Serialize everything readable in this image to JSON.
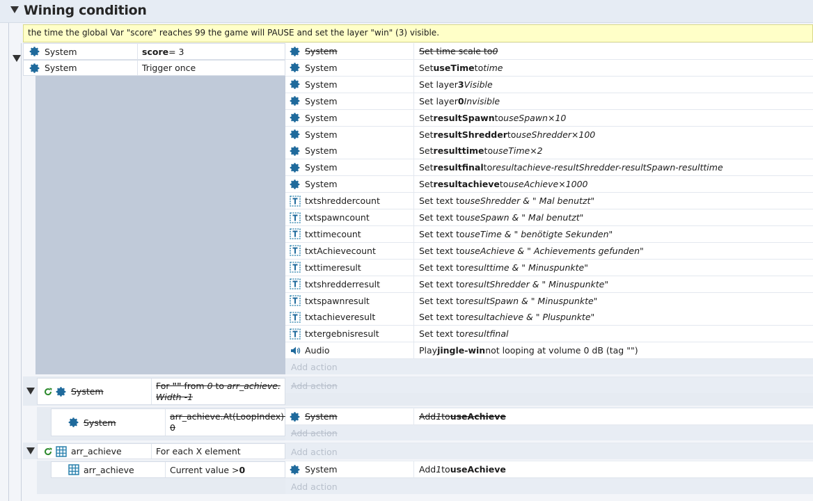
{
  "group": {
    "title": "Wining condition"
  },
  "comment": "the time the global Var \"score\" reaches 99 the game will PAUSE and set the layer \"win\" (3) visible.",
  "event1": {
    "conditions": [
      {
        "object": "System",
        "text_bold": "score",
        "text_rest": " = 3"
      },
      {
        "object": "System",
        "text": "Trigger once"
      }
    ],
    "actions": [
      {
        "object": "System",
        "icon": "gear-icon",
        "pre": "Set time scale to ",
        "italic": "0",
        "disabled": true
      },
      {
        "object": "System",
        "icon": "gear-icon",
        "pre": "Set ",
        "bold": "useTime",
        "mid": " to ",
        "italic": "time"
      },
      {
        "object": "System",
        "icon": "gear-icon",
        "pre": "Set layer ",
        "bold": "3",
        "mid": " ",
        "italic": "Visible"
      },
      {
        "object": "System",
        "icon": "gear-icon",
        "pre": "Set layer ",
        "bold": "0",
        "mid": " ",
        "italic": "Invisible"
      },
      {
        "object": "System",
        "icon": "gear-icon",
        "pre": "Set ",
        "bold": "resultSpawn",
        "mid": " to ",
        "italic": "useSpawn×10"
      },
      {
        "object": "System",
        "icon": "gear-icon",
        "pre": "Set ",
        "bold": "resultShredder",
        "mid": " to ",
        "italic": "useShredder×100"
      },
      {
        "object": "System",
        "icon": "gear-icon",
        "pre": "Set ",
        "bold": "resulttime",
        "mid": " to ",
        "italic": "useTime×2"
      },
      {
        "object": "System",
        "icon": "gear-icon",
        "pre": "Set ",
        "bold": "resultfinal",
        "mid": " to ",
        "italic": "resultachieve-resultShredder-resultSpawn-resulttime"
      },
      {
        "object": "System",
        "icon": "gear-icon",
        "pre": "Set ",
        "bold": "resultachieve",
        "mid": " to ",
        "italic": "useAchieve×1000"
      },
      {
        "object": "txtshreddercount",
        "icon": "text-icon",
        "pre": "Set text to ",
        "italic": "useShredder & \" Mal benutzt\""
      },
      {
        "object": "txtspawncount",
        "icon": "text-icon",
        "pre": "Set text to ",
        "italic": "useSpawn & \" Mal benutzt\""
      },
      {
        "object": "txttimecount",
        "icon": "text-icon",
        "pre": "Set text to ",
        "italic": "useTime & \" benötigte Sekunden\""
      },
      {
        "object": "txtAchievecount",
        "icon": "text-icon",
        "pre": "Set text to ",
        "italic": "useAchieve & \" Achievements gefunden\""
      },
      {
        "object": "txttimeresult",
        "icon": "text-icon",
        "pre": "Set text to ",
        "italic": "resulttime & \" Minuspunkte\""
      },
      {
        "object": "txtshredderresult",
        "icon": "text-icon",
        "pre": "Set text to ",
        "italic": "resultShredder & \" Minuspunkte\""
      },
      {
        "object": "txtspawnresult",
        "icon": "text-icon",
        "pre": "Set text to ",
        "italic": "resultSpawn & \" Minuspunkte\""
      },
      {
        "object": "txtachieveresult",
        "icon": "text-icon",
        "pre": "Set text to ",
        "italic": "resultachieve & \" Pluspunkte\""
      },
      {
        "object": "txtergebnisresult",
        "icon": "text-icon",
        "pre": "Set text to ",
        "italic": "resultfinal"
      },
      {
        "object": "Audio",
        "icon": "speaker-icon",
        "pre": "Play ",
        "bold": "jingle-win",
        "mid": " not looping at volume 0 dB (tag \"\")"
      }
    ],
    "add_action": "Add action"
  },
  "event2": {
    "object": "System",
    "text_pre": "For ",
    "text_bold": "\"\"",
    "text_mid": " from ",
    "text_i1": "0",
    "text_mid2": " to ",
    "text_i2": "arr_achieve.",
    "text_line2": "Width -1",
    "add_action": "Add action"
  },
  "event3": {
    "object": "System",
    "text_line1": "arr_achieve.At(LoopIndex) >",
    "text_line2": "0",
    "action_object": "System",
    "action_pre": "Add ",
    "action_italic": "1",
    "action_mid": " to ",
    "action_bold": "useAchieve",
    "add_action": "Add action"
  },
  "event4": {
    "object": "arr_achieve",
    "text": "For each X element",
    "add_action": "Add action"
  },
  "event5": {
    "object": "arr_achieve",
    "text_pre": "Current value > ",
    "text_bold": "0",
    "action_object": "System",
    "action_pre": "Add ",
    "action_italic": "1",
    "action_mid": " to ",
    "action_bold": "useAchieve",
    "add_action": "Add action"
  }
}
